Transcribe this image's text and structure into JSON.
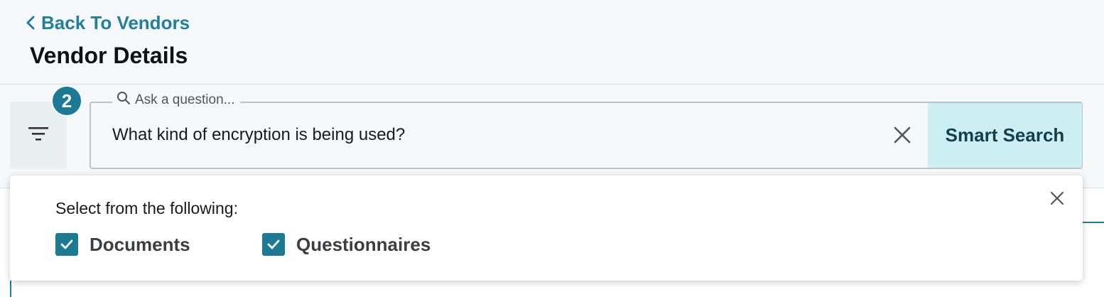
{
  "header": {
    "back_link_label": "Back To Vendors",
    "page_title": "Vendor Details"
  },
  "filter": {
    "badge_count": "2",
    "icon": "filter-icon"
  },
  "search": {
    "legend_label": "Ask a question...",
    "value": "What kind of encryption is being used?",
    "submit_label": "Smart Search",
    "clear_icon": "close-icon",
    "search_icon": "search-icon"
  },
  "filter_panel": {
    "heading": "Select from the following:",
    "options": [
      {
        "label": "Documents",
        "checked": true
      },
      {
        "label": "Questionnaires",
        "checked": true
      }
    ],
    "close_icon": "close-icon"
  },
  "colors": {
    "accent": "#1f7f9c",
    "badge": "#1c7a94",
    "smart_search_bg": "#cdeef3",
    "page_bg": "#f5f9fb"
  }
}
